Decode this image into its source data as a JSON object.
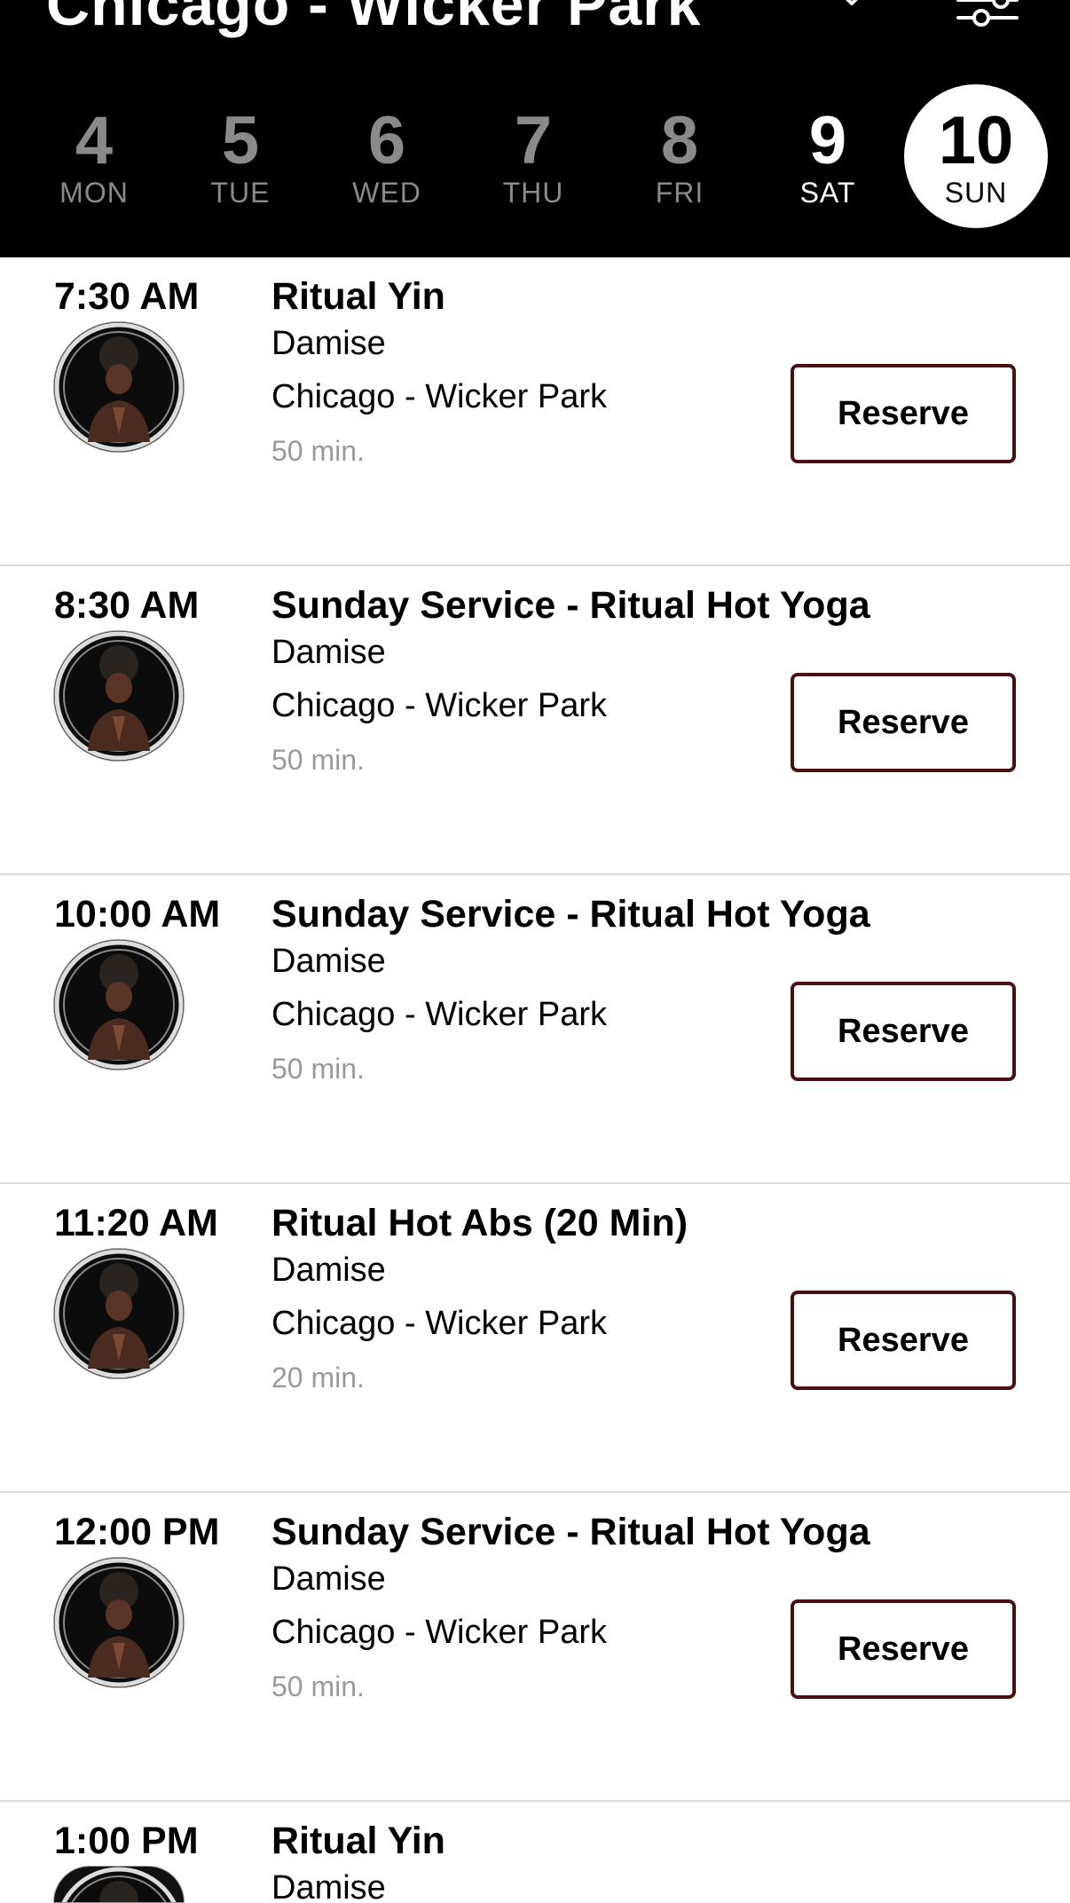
{
  "header": {
    "location_title": "Chicago - Wicker Park",
    "background_color": "#000000",
    "icons": {
      "dropdown": "chevron-down-icon",
      "filter": "filter-sliders-icon"
    },
    "days": [
      {
        "num": "4",
        "dow": "MON"
      },
      {
        "num": "5",
        "dow": "TUE"
      },
      {
        "num": "6",
        "dow": "WED"
      },
      {
        "num": "7",
        "dow": "THU"
      },
      {
        "num": "8",
        "dow": "FRI"
      },
      {
        "num": "9",
        "dow": "SAT"
      },
      {
        "num": "10",
        "dow": "SUN"
      }
    ],
    "selected_day": "10"
  },
  "classes": [
    {
      "time": "7:30 AM",
      "title": "Ritual Yin",
      "instructor": "Damise",
      "location": "Chicago - Wicker Park",
      "duration": "50 min.",
      "button": "Reserve"
    },
    {
      "time": "8:30 AM",
      "title": "Sunday Service - Ritual Hot Yoga",
      "instructor": "Damise",
      "location": "Chicago - Wicker Park",
      "duration": "50 min.",
      "button": "Reserve"
    },
    {
      "time": "10:00 AM",
      "title": "Sunday Service - Ritual Hot Yoga",
      "instructor": "Damise",
      "location": "Chicago - Wicker Park",
      "duration": "50 min.",
      "button": "Reserve"
    },
    {
      "time": "11:20 AM",
      "title": "Ritual Hot Abs (20 Min)",
      "instructor": "Damise",
      "location": "Chicago - Wicker Park",
      "duration": "20 min.",
      "button": "Reserve"
    },
    {
      "time": "12:00 PM",
      "title": "Sunday Service - Ritual Hot Yoga",
      "instructor": "Damise",
      "location": "Chicago - Wicker Park",
      "duration": "50 min.",
      "button": "Reserve"
    },
    {
      "time": "1:00 PM",
      "title": "Ritual Yin",
      "instructor": "Damise",
      "location": "",
      "duration": "",
      "button": ""
    }
  ],
  "colors": {
    "reserve_border": "#4a0f12",
    "divider": "#dcdcdc",
    "muted_text": "#9a9a9a"
  }
}
